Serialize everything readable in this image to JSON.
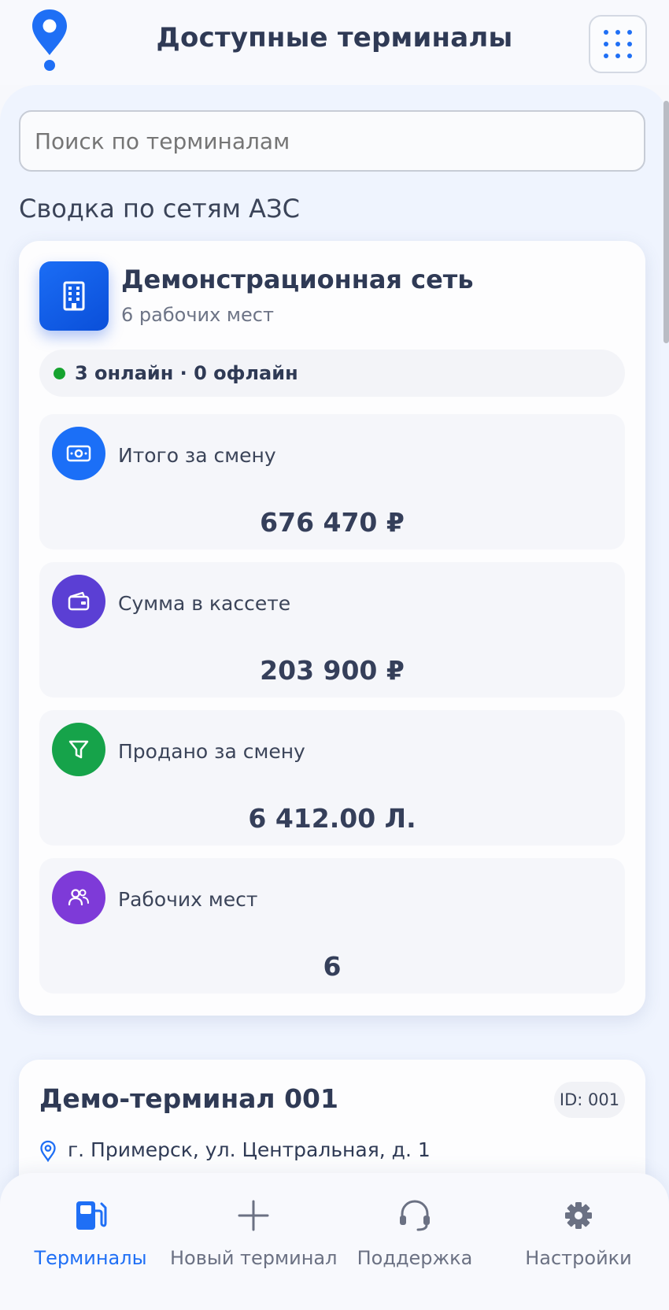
{
  "header": {
    "title": "Доступные терминалы",
    "logo_icon": "map-pin-icon",
    "menu_icon": "grid-dots-icon"
  },
  "search": {
    "placeholder": "Поиск по терминалам"
  },
  "summary": {
    "section_title": "Сводка по сетям АЗС",
    "network": {
      "name": "Демонстрационная сеть",
      "subtitle": "6 рабочих мест",
      "icon": "building-icon",
      "status_text": "3 онлайн · 0 офлайн",
      "status_color": "#16a32f",
      "stats": [
        {
          "label": "Итого за смену",
          "value": "676 470 ₽",
          "icon": "banknote-icon",
          "color": "#1b6ff7"
        },
        {
          "label": "Сумма в кассете",
          "value": "203 900 ₽",
          "icon": "wallet-icon",
          "color": "#5b3fd4"
        },
        {
          "label": "Продано за смену",
          "value": "6 412.00 Л.",
          "icon": "filter-icon",
          "color": "#16a34a"
        },
        {
          "label": "Рабочих мест",
          "value": "6",
          "icon": "users-icon",
          "color": "#7e3ad8"
        }
      ]
    }
  },
  "terminal": {
    "title": "Демо-терминал 001",
    "id_badge": "ID: 001",
    "address": "г. Примерск, ул. Центральная, д. 1"
  },
  "nav": {
    "items": [
      {
        "label": "Терминалы",
        "icon": "fuel-pump-icon",
        "active": true
      },
      {
        "label": "Новый терминал",
        "icon": "plus-icon",
        "active": false
      },
      {
        "label": "Поддержка",
        "icon": "headset-icon",
        "active": false
      },
      {
        "label": "Настройки",
        "icon": "gear-icon",
        "active": false
      }
    ]
  },
  "colors": {
    "accent": "#1f6ff5",
    "text_primary": "#2f3a55",
    "background": "#eff4fe"
  }
}
